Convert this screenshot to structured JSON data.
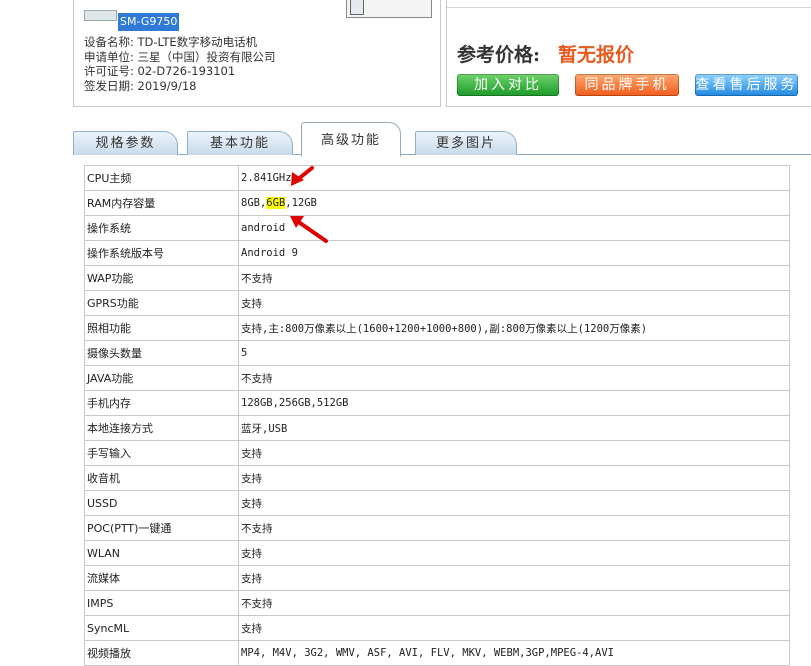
{
  "device": {
    "model": "SM-G9750",
    "lines": [
      "设备名称: TD-LTE数字移动电话机",
      "申请单位: 三星（中国）投资有限公司",
      "许可证号: 02-D726-193101",
      "签发日期: 2019/9/18"
    ]
  },
  "price": {
    "label": "参考价格:",
    "value": "暂无报价",
    "buttons": [
      "加入对比",
      "同品牌手机",
      "查看售后服务"
    ]
  },
  "tabs": [
    "规格参数",
    "基本功能",
    "高级功能",
    "更多图片"
  ],
  "active_tab": "高级功能",
  "specs": [
    {
      "k": "CPU主频",
      "v": "2.841GHz"
    },
    {
      "k": "RAM内存容量",
      "v_pre": "8GB,",
      "v_hl": "6GB",
      "v_post": ",12GB"
    },
    {
      "k": "操作系统",
      "v": "android"
    },
    {
      "k": "操作系统版本号",
      "v": "Android 9"
    },
    {
      "k": "WAP功能",
      "v": "不支持"
    },
    {
      "k": "GPRS功能",
      "v": "支持"
    },
    {
      "k": "照相功能",
      "v": "支持,主:800万像素以上(1600+1200+1000+800),副:800万像素以上(1200万像素)"
    },
    {
      "k": "摄像头数量",
      "v": "5"
    },
    {
      "k": "JAVA功能",
      "v": "不支持"
    },
    {
      "k": "手机内存",
      "v": "128GB,256GB,512GB"
    },
    {
      "k": "本地连接方式",
      "v": "蓝牙,USB"
    },
    {
      "k": "手写输入",
      "v": "支持"
    },
    {
      "k": "收音机",
      "v": "支持"
    },
    {
      "k": "USSD",
      "v": "支持"
    },
    {
      "k": "POC(PTT)一键通",
      "v": "不支持"
    },
    {
      "k": "WLAN",
      "v": "支持"
    },
    {
      "k": "流媒体",
      "v": "支持"
    },
    {
      "k": "IMPS",
      "v": "不支持"
    },
    {
      "k": "SyncML",
      "v": "支持"
    },
    {
      "k": "视频播放",
      "v": "MP4, M4V, 3G2, WMV, ASF, AVI, FLV, MKV, WEBM,3GP,MPEG-4,AVI"
    }
  ],
  "colors": {
    "price": "#e8591e",
    "highlight": "#ffff00",
    "model_bg": "#2f7ad6",
    "arrow": "#e00000"
  }
}
